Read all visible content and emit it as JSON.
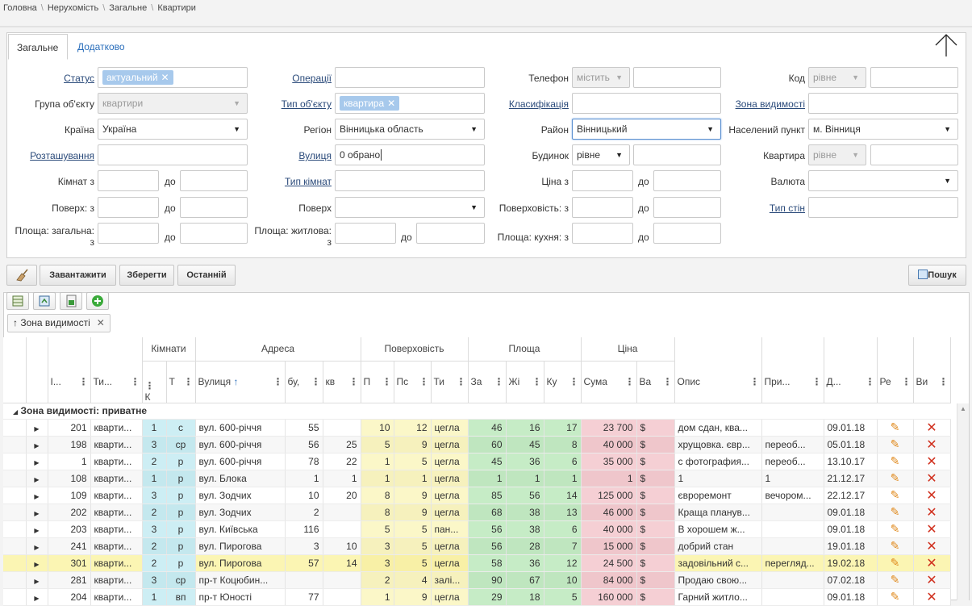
{
  "breadcrumb": [
    "Головна",
    "Нерухомість",
    "Загальне",
    "Квартири"
  ],
  "tabs": {
    "general": "Загальне",
    "extra": "Додатково"
  },
  "filters": {
    "status": {
      "label": "Статус",
      "chip": "актуальний"
    },
    "operations": {
      "label": "Операції",
      "value": ""
    },
    "phone": {
      "label": "Телефон",
      "mode": "містить",
      "value": ""
    },
    "code": {
      "label": "Код",
      "mode": "рівне",
      "value": ""
    },
    "group": {
      "label": "Група об'єкту",
      "value": "квартири"
    },
    "obj_type": {
      "label": "Тип об'єкту",
      "chip": "квартира"
    },
    "classification": {
      "label": "Класифікація",
      "value": ""
    },
    "visibility": {
      "label": "Зона видимості",
      "value": ""
    },
    "country": {
      "label": "Країна",
      "value": "Україна"
    },
    "region": {
      "label": "Регіон",
      "value": "Вінницька область"
    },
    "district": {
      "label": "Район",
      "value": "Вінницький"
    },
    "settlement": {
      "label": "Населений пункт",
      "value": "м. Вінниця"
    },
    "location": {
      "label": "Розташування",
      "value": ""
    },
    "street": {
      "label": "Вулиця",
      "value": "0 обрано"
    },
    "building": {
      "label": "Будинок",
      "mode": "рівне",
      "value": ""
    },
    "apartment": {
      "label": "Квартира",
      "mode": "рівне",
      "value": ""
    },
    "rooms_from": {
      "label": "Кімнат з",
      "to": "до"
    },
    "room_type": {
      "label": "Тип кімнат",
      "value": ""
    },
    "price_from": {
      "label": "Ціна з",
      "to": "до"
    },
    "currency": {
      "label": "Валюта",
      "value": ""
    },
    "floor_from": {
      "label": "Поверх: з",
      "to": "до"
    },
    "floor": {
      "label": "Поверх",
      "value": ""
    },
    "floors_from": {
      "label": "Поверховість: з",
      "to": "до"
    },
    "wall_type": {
      "label": "Тип стін",
      "value": ""
    },
    "area_total": {
      "label_1": "Площа: загальна:",
      "label_2": "з",
      "to": "до"
    },
    "area_living": {
      "label_1": "Площа: житлова:",
      "label_2": "з",
      "to": "до"
    },
    "area_kitchen": {
      "label": "Площа: кухня: з",
      "to": "до"
    }
  },
  "toolbar": {
    "load": "Завантажити",
    "save": "Зберегти",
    "last": "Останній",
    "search": "Пошук"
  },
  "group_chip": "Зона видимості",
  "grid": {
    "group_headers": {
      "rooms": "Кімнати",
      "address": "Адреса",
      "floors": "Поверховість",
      "area": "Площа",
      "price": "Ціна"
    },
    "columns": [
      "І...",
      "Ти...",
      "К",
      "Т",
      "Вулиця",
      "бу,",
      "кв",
      "П",
      "Пс",
      "Ти",
      "За",
      "Жі",
      "Ку",
      "Сума",
      "Ва",
      "Опис",
      "При...",
      "Д...",
      "Ре",
      "Ви"
    ],
    "group_row": "Зона видимості: приватне",
    "rows": [
      [
        "201",
        "кварти...",
        "1",
        "с",
        "вул. 600-річчя",
        "55",
        "",
        "10",
        "12",
        "цегла",
        "46",
        "16",
        "17",
        "23 700",
        "$",
        "дом сдан, ква...",
        "",
        "09.01.18"
      ],
      [
        "198",
        "кварти...",
        "3",
        "ср",
        "вул. 600-річчя",
        "56",
        "25",
        "5",
        "9",
        "цегла",
        "60",
        "45",
        "8",
        "40 000",
        "$",
        "хрущовка. євр...",
        "переоб...",
        "05.01.18"
      ],
      [
        "1",
        "кварти...",
        "2",
        "р",
        "вул. 600-річчя",
        "78",
        "22",
        "1",
        "5",
        "цегла",
        "45",
        "36",
        "6",
        "35 000",
        "$",
        "с фотография...",
        "переоб...",
        "13.10.17"
      ],
      [
        "108",
        "кварти...",
        "1",
        "р",
        "вул. Блока",
        "1",
        "1",
        "1",
        "1",
        "цегла",
        "1",
        "1",
        "1",
        "1",
        "$",
        "1",
        "1",
        "21.12.17"
      ],
      [
        "109",
        "кварти...",
        "3",
        "р",
        "вул. Зодчих",
        "10",
        "20",
        "8",
        "9",
        "цегла",
        "85",
        "56",
        "14",
        "125 000",
        "$",
        "євроремонт",
        "вечором...",
        "22.12.17"
      ],
      [
        "202",
        "кварти...",
        "2",
        "р",
        "вул. Зодчих",
        "2",
        "",
        "8",
        "9",
        "цегла",
        "68",
        "38",
        "13",
        "46 000",
        "$",
        "Краща планув...",
        "",
        "09.01.18"
      ],
      [
        "203",
        "кварти...",
        "3",
        "р",
        "вул. Київська",
        "116",
        "",
        "5",
        "5",
        "пан...",
        "56",
        "38",
        "6",
        "40 000",
        "$",
        "В хорошем ж...",
        "",
        "09.01.18"
      ],
      [
        "241",
        "кварти...",
        "2",
        "р",
        "вул. Пирогова",
        "3",
        "10",
        "3",
        "5",
        "цегла",
        "56",
        "28",
        "7",
        "15 000",
        "$",
        "добрий стан",
        "",
        "19.01.18"
      ],
      [
        "301",
        "кварти...",
        "2",
        "р",
        "вул. Пирогова",
        "57",
        "14",
        "3",
        "5",
        "цегла",
        "58",
        "36",
        "12",
        "24 500",
        "$",
        "задовільний с...",
        "перегляд...",
        "19.02.18"
      ],
      [
        "281",
        "кварти...",
        "3",
        "ср",
        "пр-т Коцюбин...",
        "",
        "",
        "2",
        "4",
        "залі...",
        "90",
        "67",
        "10",
        "84 000",
        "$",
        "Продаю свою...",
        "",
        "07.02.18"
      ],
      [
        "204",
        "кварти...",
        "1",
        "вп",
        "пр-т Юності",
        "77",
        "",
        "1",
        "9",
        "цегла",
        "29",
        "18",
        "5",
        "160 000",
        "$",
        "Гарний житло...",
        "",
        "09.01.18"
      ]
    ]
  }
}
